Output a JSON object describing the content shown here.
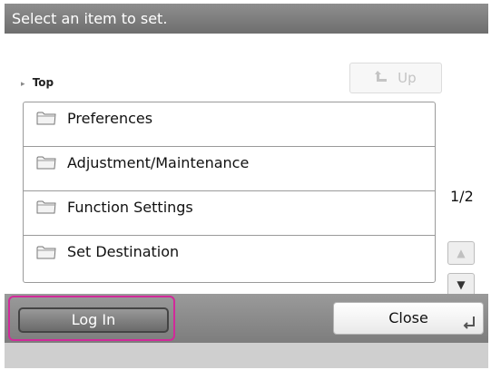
{
  "header": {
    "title": "Select an item to set."
  },
  "breadcrumb": {
    "arrow": "▸",
    "location": "Top"
  },
  "up_button": {
    "icon": "up-arrow-icon",
    "label": "Up"
  },
  "list": {
    "items": [
      {
        "icon": "folder-icon",
        "label": "Preferences"
      },
      {
        "icon": "folder-icon",
        "label": "Adjustment/Maintenance"
      },
      {
        "icon": "folder-icon",
        "label": "Function Settings"
      },
      {
        "icon": "folder-icon",
        "label": "Set Destination"
      }
    ]
  },
  "pagination": {
    "indicator": "1/2",
    "up_glyph": "▲",
    "down_glyph": "▼"
  },
  "footer": {
    "login_label": "Log In",
    "close_label": "Close",
    "highlight_color": "#d12a9a"
  }
}
